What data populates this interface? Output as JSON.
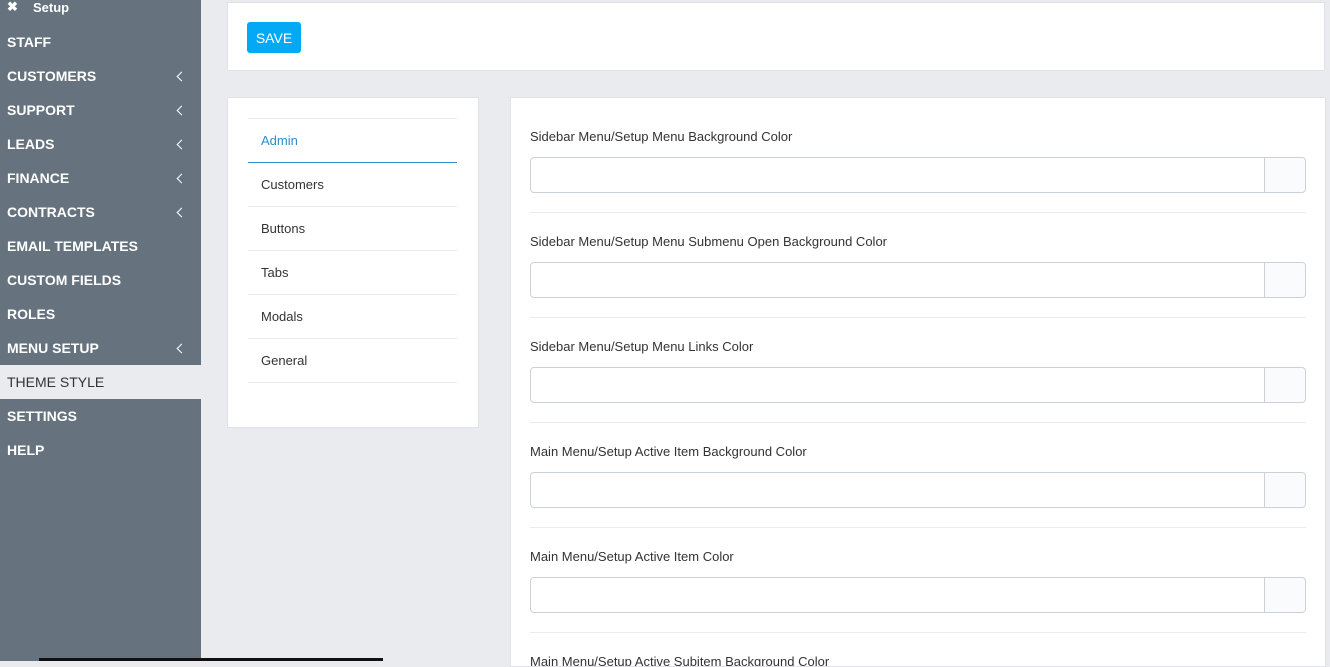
{
  "sidebar": {
    "title": "Setup",
    "close_icon": "✖",
    "items": [
      {
        "label": "STAFF",
        "has_submenu": false
      },
      {
        "label": "CUSTOMERS",
        "has_submenu": true
      },
      {
        "label": "SUPPORT",
        "has_submenu": true
      },
      {
        "label": "LEADS",
        "has_submenu": true
      },
      {
        "label": "FINANCE",
        "has_submenu": true
      },
      {
        "label": "CONTRACTS",
        "has_submenu": true
      },
      {
        "label": "EMAIL TEMPLATES",
        "has_submenu": false
      },
      {
        "label": "CUSTOM FIELDS",
        "has_submenu": false
      },
      {
        "label": "ROLES",
        "has_submenu": false
      },
      {
        "label": "MENU SETUP",
        "has_submenu": true
      },
      {
        "label": "THEME STYLE",
        "has_submenu": false,
        "active": true
      },
      {
        "label": "SETTINGS",
        "has_submenu": false
      },
      {
        "label": "HELP",
        "has_submenu": false
      }
    ]
  },
  "toolbar": {
    "save_label": "SAVE"
  },
  "tabs": [
    {
      "label": "Admin",
      "active": true
    },
    {
      "label": "Customers"
    },
    {
      "label": "Buttons"
    },
    {
      "label": "Tabs"
    },
    {
      "label": "Modals"
    },
    {
      "label": "General"
    }
  ],
  "fields": [
    {
      "label": "Sidebar Menu/Setup Menu Background Color",
      "value": ""
    },
    {
      "label": "Sidebar Menu/Setup Menu Submenu Open Background Color",
      "value": ""
    },
    {
      "label": "Sidebar Menu/Setup Menu Links Color",
      "value": ""
    },
    {
      "label": "Main Menu/Setup Active Item Background Color",
      "value": ""
    },
    {
      "label": "Main Menu/Setup Active Item Color",
      "value": ""
    },
    {
      "label": "Main Menu/Setup Active Subitem Background Color",
      "value": ""
    }
  ],
  "colors": {
    "sidebar_bg": "#66737f",
    "accent": "#03a9f4",
    "active_tab": "#2c8fc7"
  }
}
